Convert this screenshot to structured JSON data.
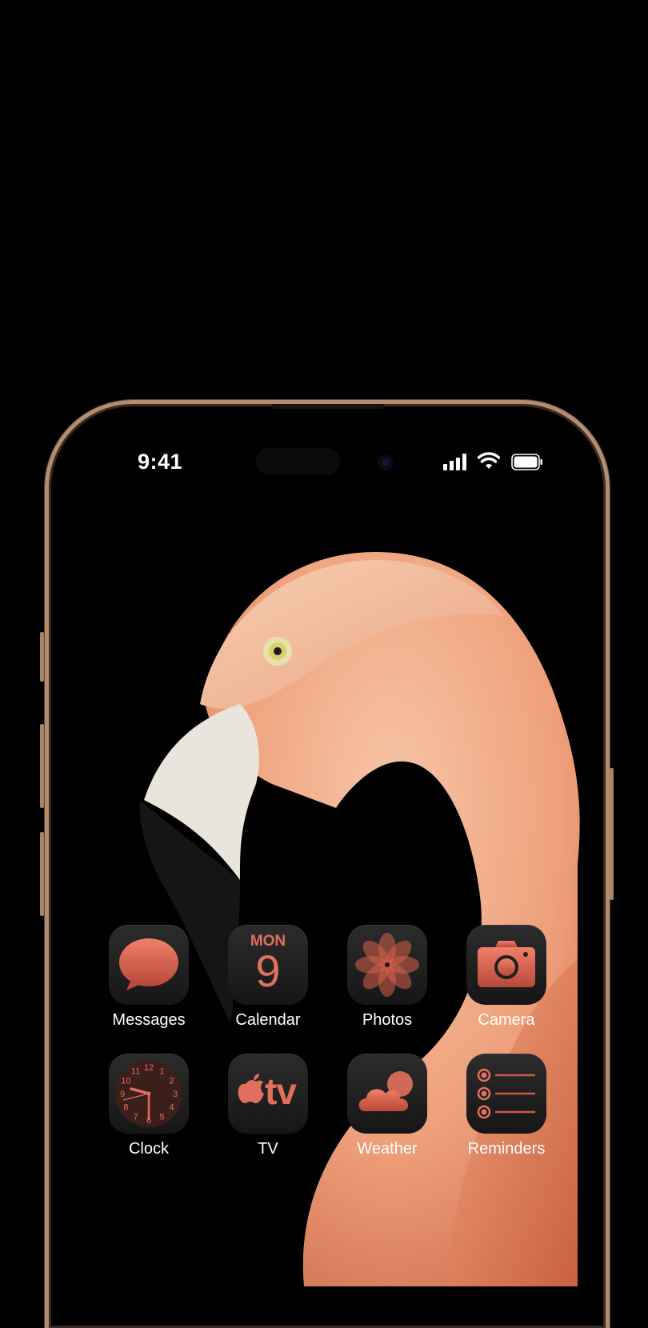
{
  "status_bar": {
    "time": "9:41"
  },
  "apps": [
    {
      "name": "Messages",
      "icon": "messages-icon"
    },
    {
      "name": "Calendar",
      "icon": "calendar-icon",
      "day_label": "MON",
      "date": "9"
    },
    {
      "name": "Photos",
      "icon": "photos-icon"
    },
    {
      "name": "Camera",
      "icon": "camera-icon"
    },
    {
      "name": "Clock",
      "icon": "clock-icon",
      "numbers": [
        "12",
        "1",
        "2",
        "3",
        "4",
        "5",
        "6",
        "7",
        "8",
        "9",
        "10",
        "11"
      ]
    },
    {
      "name": "TV",
      "icon": "tv-icon",
      "logo_text": "tv"
    },
    {
      "name": "Weather",
      "icon": "weather-icon"
    },
    {
      "name": "Reminders",
      "icon": "reminders-icon"
    }
  ],
  "colors": {
    "accent": "#e06f5e",
    "frame": "#b38d72",
    "wallpaper_bird": "#f0b08c"
  }
}
